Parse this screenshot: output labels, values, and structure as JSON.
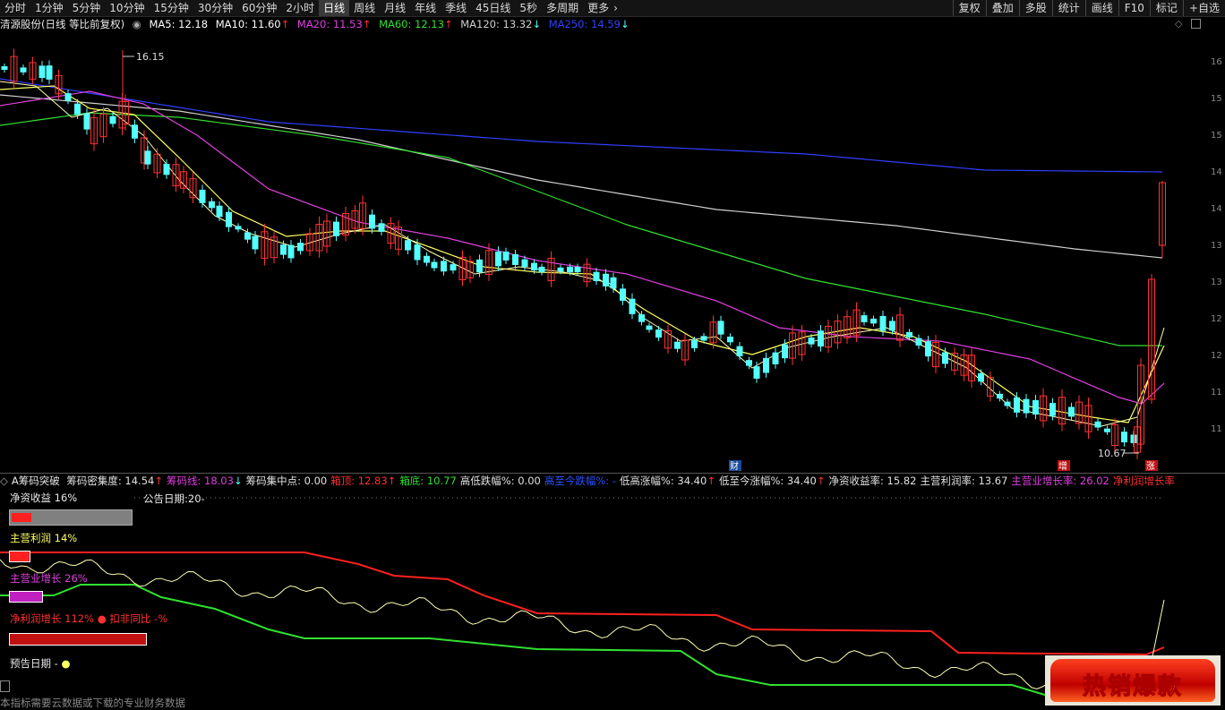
{
  "toolbar": {
    "periods": [
      "分时",
      "1分钟",
      "5分钟",
      "10分钟",
      "15分钟",
      "30分钟",
      "60分钟",
      "2小时",
      "日线",
      "周线",
      "月线",
      "年线",
      "季线",
      "45日线",
      "5秒",
      "多周期",
      "更多"
    ],
    "active_period": "日线",
    "more_arrow": "›",
    "right_tools": [
      "复权",
      "叠加",
      "多股",
      "统计",
      "画线",
      "F10",
      "标记",
      "+自选"
    ]
  },
  "chart_header": {
    "title": "清源股份(日线 等比前复权)",
    "ma5": "MA5: 12.18",
    "ma10": "MA10: 11.60",
    "ma20": "MA20: 11.53",
    "ma60": "MA60: 12.13",
    "ma120": "MA120: 13.32",
    "ma250": "MA250: 14.59",
    "up_arrow": "↑",
    "down_arrow": "↓"
  },
  "annotations": {
    "high_price": "16.15",
    "low_price": "10.67",
    "marker_cai": "财",
    "marker_zeng": "增",
    "marker_zhang": "涨"
  },
  "indicator": {
    "name": "A筹码突破",
    "items": [
      {
        "text": "筹码密集度: 14.54",
        "arrow": "↑",
        "color": "#e0e0e0"
      },
      {
        "text": "筹码线: 18.03",
        "arrow": "↓",
        "color": "#e040e0"
      },
      {
        "text": "筹码集中点: 0.00",
        "arrow": "",
        "color": "#e0e0e0"
      },
      {
        "text": "箱顶: 12.83",
        "arrow": "↑",
        "color": "#ff3030"
      },
      {
        "text": "箱底: 10.77",
        "arrow": "",
        "color": "#30e030"
      },
      {
        "text": "高低跌幅%: 0.00",
        "arrow": "",
        "color": "#e0e0e0"
      },
      {
        "text": "高至今跌幅%: -",
        "arrow": "",
        "color": "#3050ff"
      },
      {
        "text": "低高涨幅%: 34.40",
        "arrow": "↑",
        "color": "#e0e0e0"
      },
      {
        "text": "低至今涨幅%: 34.40",
        "arrow": "↑",
        "color": "#e0e0e0"
      },
      {
        "text": "净资收益率: 15.82",
        "arrow": "",
        "color": "#e0e0e0"
      },
      {
        "text": "主营利润率: 13.67",
        "arrow": "",
        "color": "#e0e0e0"
      },
      {
        "text": "主营业增长率: 26.02",
        "arrow": "",
        "color": "#e040e0"
      },
      {
        "text": "净利润增长率",
        "arrow": "",
        "color": "#ff3030"
      }
    ]
  },
  "sub_panel": {
    "roe_label": "净资收益 16%",
    "announce_label": "公告日期:20-",
    "profit_label": "主营利润 14%",
    "revenue_label": "主营业增长 26%",
    "netprofit_label": "净利润增长 112%",
    "deduct_label": "● 扣非同比 -%",
    "forecast_label": "预告日期 -",
    "forecast_dot": "●",
    "roe_fill": 0.16,
    "profit_fill": 0.14,
    "revenue_fill": 0.26,
    "netprofit_fill": 1.0
  },
  "footer_text": "本指标需要云数据或下载的专业财务数据",
  "promo": {
    "text": "热销爆款"
  },
  "colors": {
    "up": "#ff3232",
    "down": "#54ffff",
    "ma5": "#ffffff",
    "ma10": "#ffff60",
    "ma20": "#e040e0",
    "ma60": "#30e030",
    "ma120": "#d0d0d0",
    "ma250": "#3040ff"
  },
  "axis_labels": [
    "16",
    "15",
    "15",
    "14",
    "14",
    "13",
    "13",
    "12",
    "12",
    "11",
    "11"
  ]
}
